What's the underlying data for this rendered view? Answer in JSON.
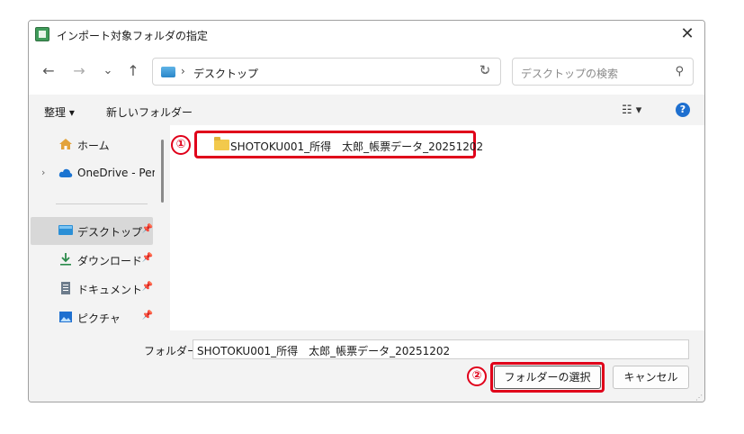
{
  "window": {
    "title": "インポート対象フォルダの指定",
    "close_glyph": "✕"
  },
  "nav": {
    "back": "←",
    "forward": "→",
    "recent": "⌄",
    "up": "↑"
  },
  "address": {
    "separator": "›",
    "path": "デスクトップ",
    "dropdown_glyph": "⌄",
    "refresh_glyph": "↻"
  },
  "search": {
    "placeholder": "デスクトップの検索",
    "icon_glyph": "⚲"
  },
  "toolbar": {
    "organize": "整理 ▾",
    "new_folder": "新しいフォルダー",
    "view_glyph": "☷ ▾",
    "help_glyph": "?"
  },
  "sidebar": {
    "items": [
      {
        "label": "ホーム",
        "icon": "home-icon"
      },
      {
        "label": "OneDrive - Perso",
        "icon": "cloud-icon",
        "expand": "›"
      },
      {
        "label": "デスクトップ",
        "icon": "desktop-icon",
        "pin": "📌"
      },
      {
        "label": "ダウンロード",
        "icon": "download-icon",
        "pin": "📌"
      },
      {
        "label": "ドキュメント",
        "icon": "document-icon",
        "pin": "📌"
      },
      {
        "label": "ピクチャ",
        "icon": "pictures-icon",
        "pin": "📌"
      }
    ]
  },
  "content": {
    "folder_name": "SHOTOKU001_所得　太郎_帳票データ_20251202"
  },
  "annotations": {
    "step1": "①",
    "step2": "②",
    "accent_color": "#e0001a"
  },
  "footer": {
    "folder_label": "フォルダー:",
    "folder_value": "SHOTOKU001_所得　太郎_帳票データ_20251202",
    "select_button": "フォルダーの選択",
    "cancel_button": "キャンセル"
  }
}
